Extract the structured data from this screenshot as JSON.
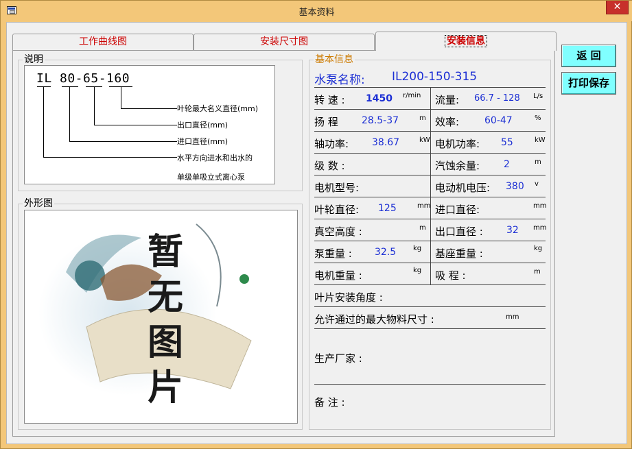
{
  "window": {
    "title": "基本资料",
    "close_glyph": "✕"
  },
  "tabs": [
    {
      "label": "工作曲线图"
    },
    {
      "label": "安装尺寸图"
    },
    {
      "label": "安装信息",
      "active": true
    }
  ],
  "description": {
    "group_label": "说明",
    "model_code": "IL  80-65-160",
    "annotations": [
      "叶轮最大名义直径(mm)",
      "出口直径(mm)",
      "进口直径(mm)",
      "水平方向进水和出水的",
      "单级单吸立式离心泵"
    ]
  },
  "shape": {
    "group_label": "外形图",
    "placeholder_chars": [
      "暂",
      "无",
      "图",
      "片"
    ]
  },
  "info": {
    "group_label": "基本信息",
    "pump_name_label": "水泵名称:",
    "pump_name_value": "IL200-150-315",
    "rows": [
      {
        "left_label": "转 速 :",
        "left_value": "1450",
        "left_unit": "r/min",
        "right_label": "流量:",
        "right_value": "66.7 - 128",
        "right_unit": "L/s"
      },
      {
        "left_label": "扬 程",
        "left_value": "28.5-37",
        "left_unit": "m",
        "right_label": "效率:",
        "right_value": "60-47",
        "right_unit": "%"
      },
      {
        "left_label": "轴功率:",
        "left_value": "38.67",
        "left_unit": "kW",
        "right_label": "电机功率:",
        "right_value": "55",
        "right_unit": "kW"
      },
      {
        "left_label": "级 数 :",
        "left_value": "",
        "left_unit": "",
        "right_label": "汽蚀余量:",
        "right_value": "2",
        "right_unit": "m"
      },
      {
        "left_label": "电机型号:",
        "left_value": "",
        "left_unit": "",
        "right_label": "电动机电压:",
        "right_value": "380",
        "right_unit": "v"
      },
      {
        "left_label": "叶轮直径:",
        "left_value": "125",
        "left_unit": "mm",
        "right_label": "进口直径:",
        "right_value": "",
        "right_unit": "mm"
      },
      {
        "left_label": "真空高度 :",
        "left_value": "",
        "left_unit": "m",
        "right_label": "出口直径 :",
        "right_value": "32",
        "right_unit": "mm"
      },
      {
        "left_label": "泵重量 :",
        "left_value": "32.5",
        "left_unit": "kg",
        "right_label": "基座重量 :",
        "right_value": "",
        "right_unit": "kg"
      },
      {
        "left_label": "电机重量 :",
        "left_value": "",
        "left_unit": "kg",
        "right_label": "吸 程 :",
        "right_value": "",
        "right_unit": "m"
      }
    ],
    "blade_angle_label": "叶片安装角度 :",
    "max_material_label": "允许通过的最大物料尺寸 :",
    "max_material_unit": "mm",
    "manufacturer_label": "生产厂家 :",
    "remarks_label": "备 注 :"
  },
  "buttons": {
    "back": "返 回",
    "print_save": "打印保存"
  }
}
